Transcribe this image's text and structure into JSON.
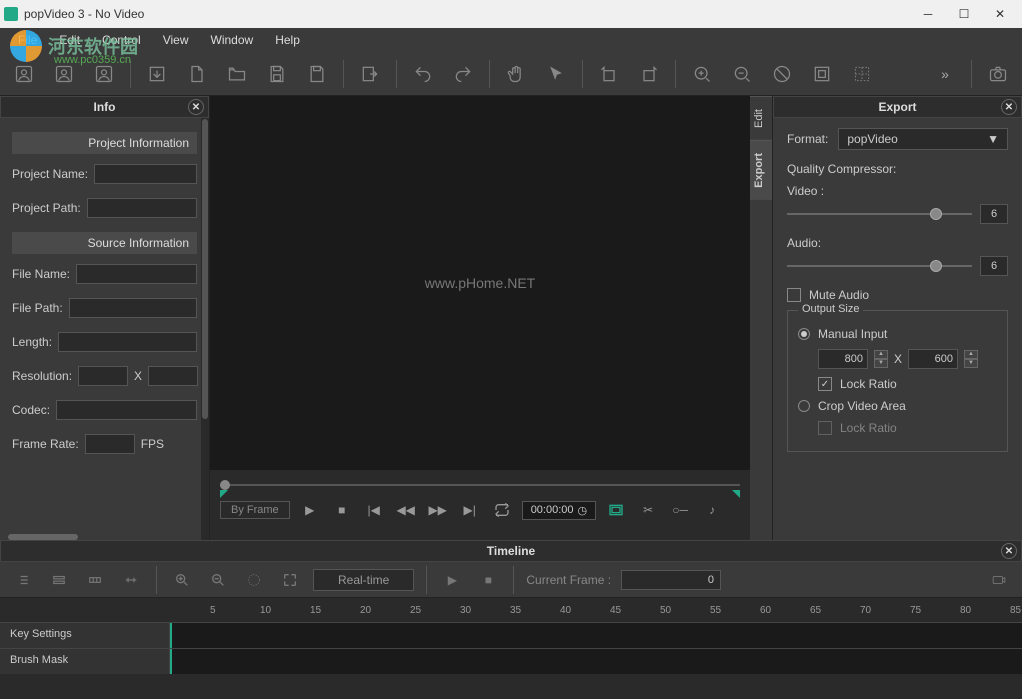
{
  "window": {
    "title": "popVideo 3 - No Video"
  },
  "menu": [
    "File",
    "Edit",
    "Control",
    "View",
    "Window",
    "Help"
  ],
  "watermark": {
    "text": "河东软件园",
    "url": "www.pc0359.cn",
    "center": "www.pHome.NET"
  },
  "info_panel": {
    "title": "Info",
    "sections": {
      "project": "Project Information",
      "source": "Source Information"
    },
    "labels": {
      "project_name": "Project Name:",
      "project_path": "Project Path:",
      "file_name": "File Name:",
      "file_path": "File Path:",
      "length": "Length:",
      "resolution": "Resolution:",
      "res_x": "X",
      "codec": "Codec:",
      "frame_rate": "Frame Rate:",
      "fps": "FPS"
    }
  },
  "playback": {
    "by_frame": "By Frame",
    "time": "00:00:00"
  },
  "right_tabs": {
    "edit": "Edit",
    "export": "Export"
  },
  "export_panel": {
    "title": "Export",
    "format_label": "Format:",
    "format_value": "popVideo",
    "quality_label": "Quality Compressor:",
    "video_label": "Video :",
    "video_value": "6",
    "audio_label": "Audio:",
    "audio_value": "6",
    "mute_audio": "Mute Audio",
    "output_size": "Output Size",
    "manual_input": "Manual Input",
    "width": "800",
    "size_x": "X",
    "height": "600",
    "lock_ratio": "Lock Ratio",
    "crop_video": "Crop Video Area",
    "crop_lock": "Lock Ratio"
  },
  "timeline": {
    "title": "Timeline",
    "realtime": "Real-time",
    "current_frame_label": "Current Frame :",
    "current_frame_value": "0",
    "ruler": [
      "5",
      "10",
      "15",
      "20",
      "25",
      "30",
      "35",
      "40",
      "45",
      "50",
      "55",
      "60",
      "65",
      "70",
      "75",
      "80",
      "85"
    ],
    "tracks": {
      "key_settings": "Key Settings",
      "brush_mask": "Brush Mask"
    }
  }
}
